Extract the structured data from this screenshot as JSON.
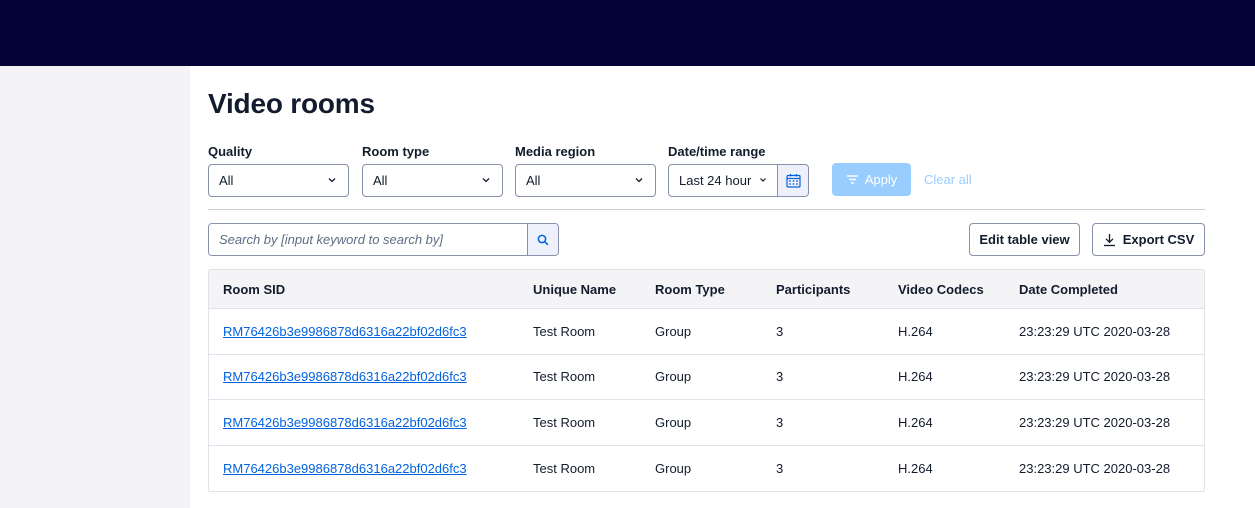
{
  "page": {
    "title": "Video rooms"
  },
  "filters": {
    "quality": {
      "label": "Quality",
      "value": "All"
    },
    "room_type": {
      "label": "Room type",
      "value": "All"
    },
    "media_region": {
      "label": "Media region",
      "value": "All"
    },
    "date_range": {
      "label": "Date/time range",
      "value": "Last 24 hour"
    },
    "apply_label": "Apply",
    "clear_label": "Clear all"
  },
  "search": {
    "placeholder": "Search by [input keyword to search by]"
  },
  "toolbar": {
    "edit_label": "Edit table view",
    "export_label": "Export CSV"
  },
  "table": {
    "columns": [
      "Room SID",
      "Unique Name",
      "Room Type",
      "Participants",
      "Video Codecs",
      "Date Completed"
    ],
    "rows": [
      {
        "sid": "RM76426b3e9986878d6316a22bf02d6fc3",
        "name": "Test Room",
        "type": "Group",
        "participants": "3",
        "codec": "H.264",
        "completed": "23:23:29 UTC 2020-03-28"
      },
      {
        "sid": "RM76426b3e9986878d6316a22bf02d6fc3",
        "name": "Test Room",
        "type": "Group",
        "participants": "3",
        "codec": "H.264",
        "completed": "23:23:29 UTC 2020-03-28"
      },
      {
        "sid": "RM76426b3e9986878d6316a22bf02d6fc3",
        "name": "Test Room",
        "type": "Group",
        "participants": "3",
        "codec": "H.264",
        "completed": "23:23:29 UTC 2020-03-28"
      },
      {
        "sid": "RM76426b3e9986878d6316a22bf02d6fc3",
        "name": "Test Room",
        "type": "Group",
        "participants": "3",
        "codec": "H.264",
        "completed": "23:23:29 UTC 2020-03-28"
      }
    ]
  },
  "icons": {
    "chevron": "chevron-down-icon",
    "calendar": "calendar-icon",
    "filter": "filter-icon",
    "search": "search-icon",
    "download": "download-icon"
  },
  "colors": {
    "topbar": "#06033a",
    "link": "#0263e0",
    "apply_disabled": "#99cdff",
    "sidebar": "#f4f4f6"
  }
}
